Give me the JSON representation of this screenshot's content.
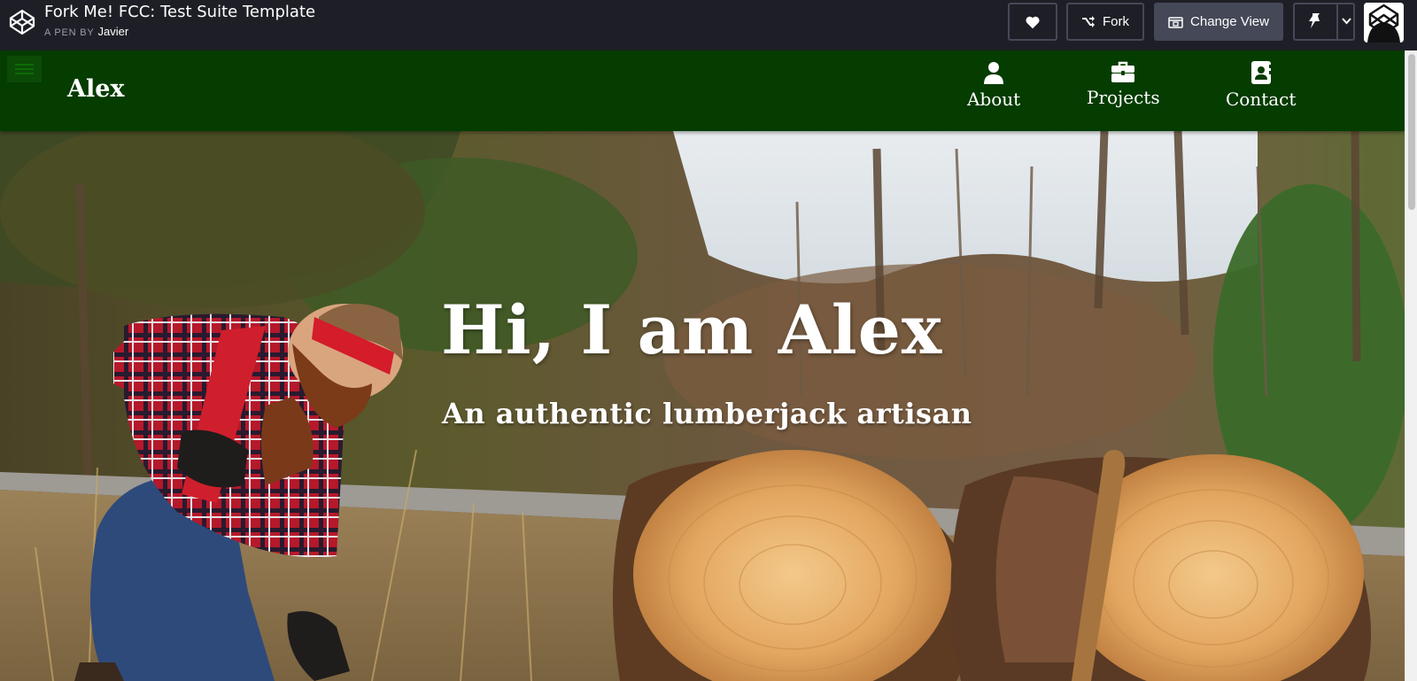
{
  "codepen": {
    "title": "Fork Me! FCC: Test Suite Template",
    "byline_prefix": "A PEN BY",
    "author": "Javier",
    "fork_label": "Fork",
    "change_view_label": "Change View",
    "icons": [
      "codepen-logo-icon",
      "heart-icon",
      "fork-icon",
      "change-view-icon",
      "pin-icon",
      "chevron-down-icon",
      "user-avatar"
    ]
  },
  "site": {
    "brand": "Alex",
    "nav": [
      {
        "label": "About",
        "icon": "user-icon"
      },
      {
        "label": "Projects",
        "icon": "briefcase-icon"
      },
      {
        "label": "Contact",
        "icon": "address-book-icon"
      }
    ],
    "hero": {
      "title": "Hi, I am Alex",
      "subtitle": "An authentic lumberjack artisan"
    },
    "colors": {
      "nav_bg": "#053c00",
      "codepen_bar": "#1e1f26",
      "codepen_button_border": "#444857"
    }
  }
}
